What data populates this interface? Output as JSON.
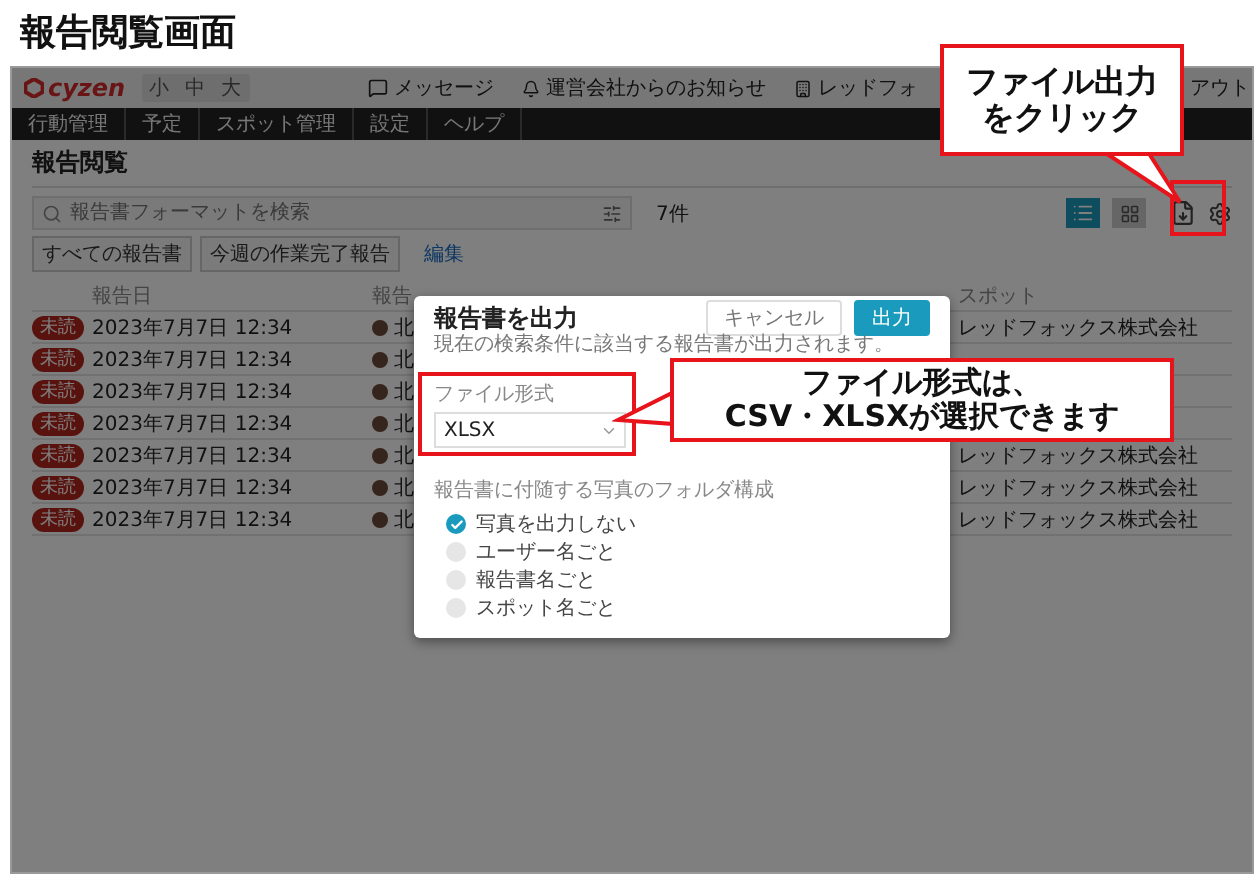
{
  "page_title": "報告閲覧画面",
  "header": {
    "logo": "cyzen",
    "font_sizes": [
      "小",
      "中",
      "大"
    ],
    "links": [
      {
        "kind": "message",
        "label": "メッセージ"
      },
      {
        "kind": "notice",
        "label": "運営会社からのお知らせ"
      },
      {
        "kind": "company",
        "label": "レッドフォ"
      },
      {
        "kind": "logout",
        "label": "アウト"
      }
    ]
  },
  "nav": [
    "行動管理",
    "予定",
    "スポット管理",
    "設定",
    "ヘルプ"
  ],
  "content": {
    "title": "報告閲覧",
    "search": {
      "placeholder": "報告書フォーマットを検索"
    },
    "count": "7件",
    "views": [
      {
        "kind": "list",
        "selected": true
      },
      {
        "kind": "grid",
        "selected": false
      }
    ],
    "filters": [
      "すべての報告書",
      "今週の作業完了報告"
    ],
    "edit_link": "編集"
  },
  "table": {
    "columns": [
      "報告日",
      "報告",
      "スポット"
    ],
    "rows": [
      {
        "status": "未読",
        "date": "2023年7月7日 12:34",
        "reporter": "北",
        "spot": "レッドフォックス株式会社"
      },
      {
        "status": "未読",
        "date": "2023年7月7日 12:34",
        "reporter": "北"
      },
      {
        "status": "未読",
        "date": "2023年7月7日 12:34",
        "reporter": "北"
      },
      {
        "status": "未読",
        "date": "2023年7月7日 12:34",
        "reporter": "北"
      },
      {
        "status": "未読",
        "date": "2023年7月7日 12:34",
        "reporter": "北",
        "spot": "レッドフォックス株式会社"
      },
      {
        "status": "未読",
        "date": "2023年7月7日 12:34",
        "reporter": "北",
        "spot": "レッドフォックス株式会社"
      },
      {
        "status": "未読",
        "date": "2023年7月7日 12:34",
        "reporter": "北",
        "spot": "レッドフォックス株式会社"
      }
    ]
  },
  "modal": {
    "title": "報告書を出力",
    "description": "現在の検索条件に該当する報告書が出力されます。",
    "cancel": "キャンセル",
    "submit": "出力",
    "format_label": "ファイル形式",
    "format_value": "XLSX",
    "photo_label": "報告書に付随する写真のフォルダ構成",
    "photo_options": [
      {
        "label": "写真を出力しない",
        "selected": true
      },
      {
        "label": "ユーザー名ごと",
        "selected": false
      },
      {
        "label": "報告書名ごと",
        "selected": false
      },
      {
        "label": "スポット名ごと",
        "selected": false
      }
    ]
  },
  "callouts": [
    {
      "kind": "export",
      "lines": [
        "ファイル出力",
        "をクリック"
      ]
    },
    {
      "kind": "format",
      "lines": [
        "ファイル形式は、",
        "CSV・XLSXが選択できます"
      ]
    }
  ]
}
